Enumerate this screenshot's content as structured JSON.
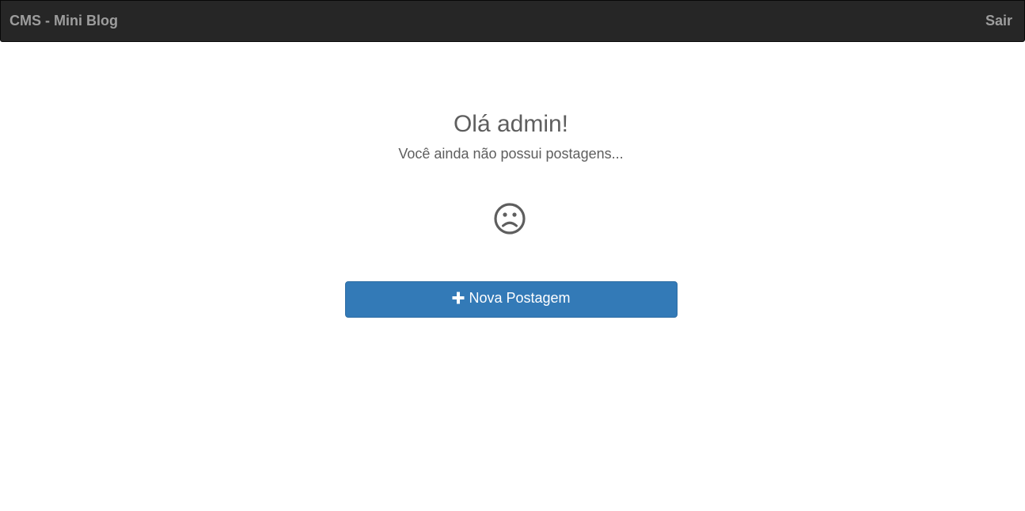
{
  "navbar": {
    "brand": "CMS - Mini Blog",
    "logout_label": "Sair"
  },
  "main": {
    "greeting": "Olá admin!",
    "empty_message": "Você ainda não possui postagens...",
    "empty_icon": "sad-face-icon",
    "new_post_label": "Nova Postagem",
    "new_post_icon": "plus-icon"
  },
  "colors": {
    "navbar_bg": "#262626",
    "navbar_text": "#9d9d9d",
    "primary": "#337ab7",
    "body_text": "#5e5e5e"
  }
}
